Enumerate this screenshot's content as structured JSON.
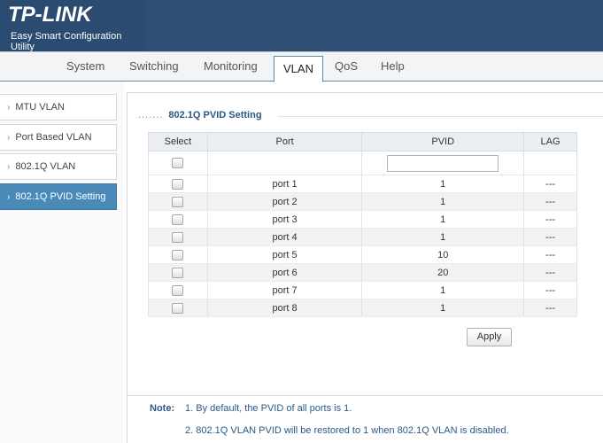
{
  "header": {
    "logo": "TP-LINK",
    "tagline": "Easy Smart Configuration Utility"
  },
  "nav": {
    "tabs": [
      "System",
      "Switching",
      "Monitoring",
      "VLAN",
      "QoS",
      "Help"
    ],
    "active": "VLAN"
  },
  "sidebar": {
    "items": [
      {
        "label": "MTU VLAN"
      },
      {
        "label": "Port Based VLAN"
      },
      {
        "label": "802.1Q VLAN"
      },
      {
        "label": "802.1Q PVID Setting"
      }
    ],
    "active": "802.1Q PVID Setting"
  },
  "main": {
    "section_title": "802.1Q PVID Setting",
    "table": {
      "headers": [
        "Select",
        "Port",
        "PVID",
        "LAG"
      ],
      "rows": [
        {
          "port": "port 1",
          "pvid": "1",
          "lag": "---"
        },
        {
          "port": "port 2",
          "pvid": "1",
          "lag": "---"
        },
        {
          "port": "port 3",
          "pvid": "1",
          "lag": "---"
        },
        {
          "port": "port 4",
          "pvid": "1",
          "lag": "---"
        },
        {
          "port": "port 5",
          "pvid": "10",
          "lag": "---"
        },
        {
          "port": "port 6",
          "pvid": "20",
          "lag": "---"
        },
        {
          "port": "port 7",
          "pvid": "1",
          "lag": "---"
        },
        {
          "port": "port 8",
          "pvid": "1",
          "lag": "---"
        }
      ],
      "pvid_input_value": ""
    },
    "apply_label": "Apply",
    "note": {
      "label": "Note:",
      "lines": [
        "1. By default, the PVID of all ports is 1.",
        "2. 802.1Q VLAN PVID will be restored to 1 when 802.1Q VLAN is disabled."
      ]
    }
  },
  "colors": {
    "header_bg": "#2e4e74",
    "accent": "#4a8ab9",
    "text_blue": "#2a5a86"
  },
  "icons": {
    "sidebar_arrow": "chevron-right-icon"
  }
}
